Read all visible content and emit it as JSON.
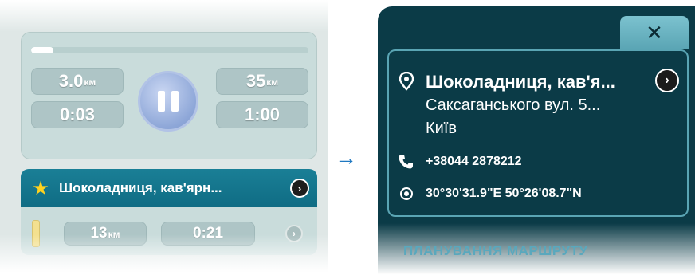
{
  "colors": {
    "accent_teal": "#0f6c84",
    "panel_dark": "#0b3b47",
    "star": "#ffd21f",
    "pause_button": "#8ea7d8",
    "close_tab": "#7cc2cf",
    "route_heading": "#5aa8bd",
    "arrow": "#1f78c1"
  },
  "navigation": {
    "progress_fraction": 0.08,
    "left_distance": {
      "value": "3.0",
      "unit": "км"
    },
    "left_time": "0:03",
    "right_distance": {
      "value": "35",
      "unit": "км"
    },
    "right_time": "1:00",
    "pause_icon": "pause-icon"
  },
  "poi_list_item": {
    "icon": "star-icon",
    "title": "Шоколадниця, кав'ярн...",
    "arrow_icon": "chevron-right-icon",
    "distance": {
      "value": "13",
      "unit": "км"
    },
    "time": "0:21"
  },
  "transition_arrow": "→",
  "detail_panel": {
    "close_label": "✕",
    "name": "Шоколадниця, кав'я...",
    "address_street": "Саксаганського вул. 5...",
    "address_city": "Київ",
    "phone_icon": "phone-icon",
    "phone": "+38044 2878212",
    "coords_icon": "location-target-icon",
    "coordinates": "30°30'31.9\"E  50°26'08.7\"N",
    "route_heading": "ПЛАНУВАННЯ МАРШРУТУ"
  }
}
